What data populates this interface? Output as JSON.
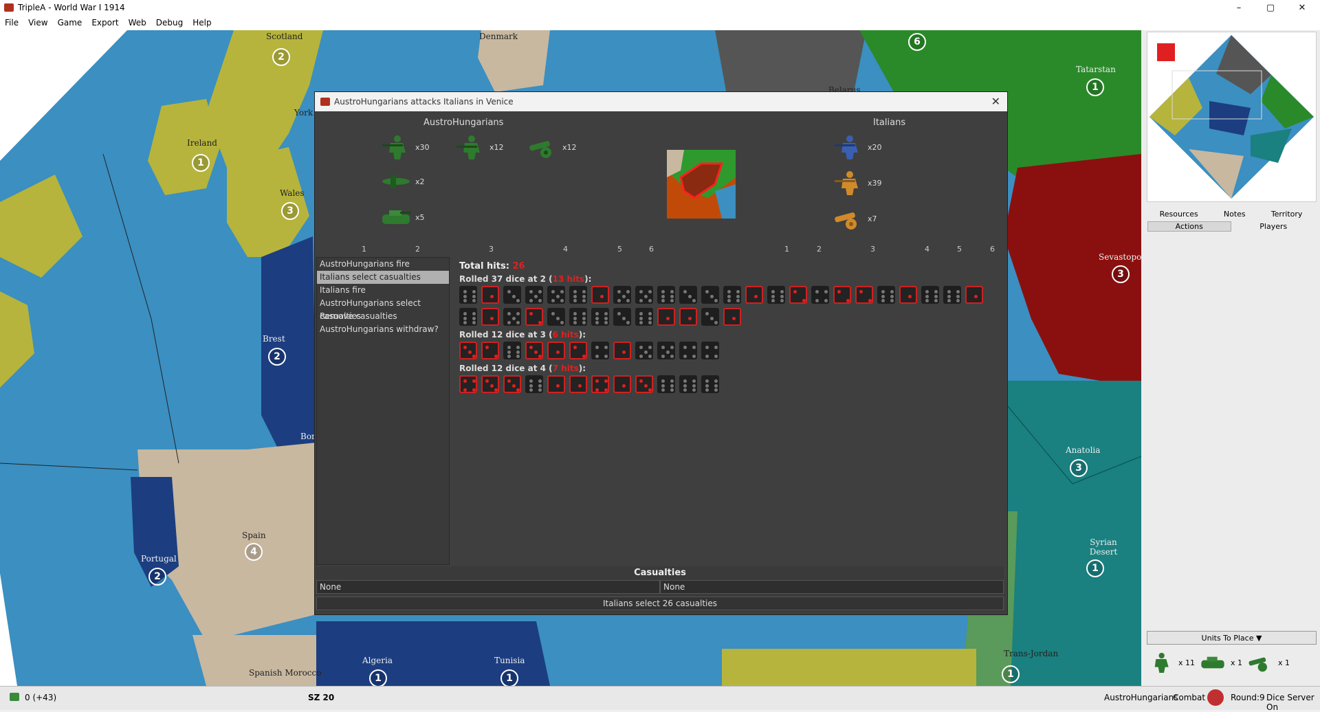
{
  "window": {
    "title": "TripleA - World War I 1914",
    "minimize": "–",
    "maximize": "▢",
    "close": "✕"
  },
  "menu": [
    "File",
    "View",
    "Game",
    "Export",
    "Web",
    "Debug",
    "Help"
  ],
  "map": {
    "labels": [
      {
        "text": "Scotland"
      },
      {
        "text": "Denmark"
      },
      {
        "text": "Belarus"
      },
      {
        "text": "Ireland"
      },
      {
        "text": "York"
      },
      {
        "text": "Wales"
      },
      {
        "text": "Brest"
      },
      {
        "text": "Bor"
      },
      {
        "text": "Spain"
      },
      {
        "text": "Portugal"
      },
      {
        "text": "Algeria"
      },
      {
        "text": "Tunisia"
      },
      {
        "text": "Spanish Morocco"
      },
      {
        "text": "Tatarstan"
      },
      {
        "text": "Sevastopol"
      },
      {
        "text": "Anatolia"
      },
      {
        "text": "Syrian Desert"
      },
      {
        "text": "Trans-Jordan"
      }
    ],
    "badges": [
      "2",
      "1",
      "3",
      "2",
      "4",
      "2",
      "1",
      "1",
      "6",
      "1",
      "3",
      "3",
      "1",
      "1"
    ]
  },
  "dialog": {
    "title": "AustroHungarians attacks Italians in Venice",
    "close": "✕",
    "attacker": {
      "name": "AustroHungarians",
      "units": [
        {
          "type": "infantry",
          "count": "x30",
          "color": "#2e7a2e"
        },
        {
          "type": "infantry-elite",
          "count": "x12",
          "color": "#2e7a2e"
        },
        {
          "type": "artillery",
          "count": "x12",
          "color": "#2e7a2e"
        },
        {
          "type": "fighter",
          "count": "x2",
          "color": "#2e7a2e"
        },
        {
          "type": "tank",
          "count": "x5",
          "color": "#2e7a2e"
        }
      ]
    },
    "defender": {
      "name": "Italians",
      "units": [
        {
          "type": "infantry",
          "count": "x20",
          "color": "#3a5fb0"
        },
        {
          "type": "infantry",
          "count": "x39",
          "color": "#d08a2a"
        },
        {
          "type": "artillery",
          "count": "x7",
          "color": "#d08a2a"
        }
      ]
    },
    "attacker_roll_headers": [
      "1",
      "2",
      "3",
      "4",
      "5",
      "6"
    ],
    "defender_roll_headers": [
      "1",
      "2",
      "3",
      "4",
      "5",
      "6"
    ],
    "steps": [
      "AustroHungarians fire",
      "Italians select casualties",
      "Italians fire",
      "AustroHungarians select casualties",
      "Remove casualties",
      "AustroHungarians withdraw?"
    ],
    "selected_step": 1,
    "total_hits_label": "Total hits:",
    "total_hits": "26",
    "rolls": [
      {
        "prefix": "Rolled 37 dice at 2 (",
        "hits": "13 hits",
        "suffix": "):",
        "dice": [
          6,
          1,
          3,
          5,
          5,
          6,
          1,
          5,
          5,
          6,
          3,
          3,
          6,
          1,
          6,
          2,
          4,
          2,
          2,
          6,
          1,
          6,
          6,
          1,
          6,
          1,
          5,
          2,
          3,
          6,
          6,
          3,
          6,
          1,
          1,
          3,
          1
        ]
      },
      {
        "prefix": "Rolled 12 dice at 3 (",
        "hits": "6 hits",
        "suffix": "):",
        "dice": [
          3,
          2,
          6,
          3,
          1,
          2,
          4,
          1,
          5,
          5,
          4,
          4
        ]
      },
      {
        "prefix": "Rolled 12 dice at 4 (",
        "hits": "7 hits",
        "suffix": "):",
        "dice": [
          4,
          3,
          3,
          6,
          1,
          1,
          4,
          1,
          3,
          6,
          6,
          6
        ]
      }
    ],
    "thresholds": [
      2,
      3,
      4
    ],
    "casualties": {
      "title": "Casualties",
      "attacker": "None",
      "defender": "None",
      "button": "Italians select 26 casualties"
    }
  },
  "side": {
    "tabs_row1": [
      "Resources",
      "Notes",
      "Territory"
    ],
    "tabs_row2": [
      "Actions",
      "Players"
    ],
    "units_to_place": "Units To Place ▼",
    "units": [
      {
        "count": "x 11"
      },
      {
        "count": "x 1"
      },
      {
        "count": "x 1"
      }
    ]
  },
  "status": {
    "pus": "0 (+43)",
    "territory": "SZ 20",
    "player": "AustroHungarians",
    "phase": "Combat",
    "round": "Round:9",
    "dice_server": "Dice Server On"
  }
}
